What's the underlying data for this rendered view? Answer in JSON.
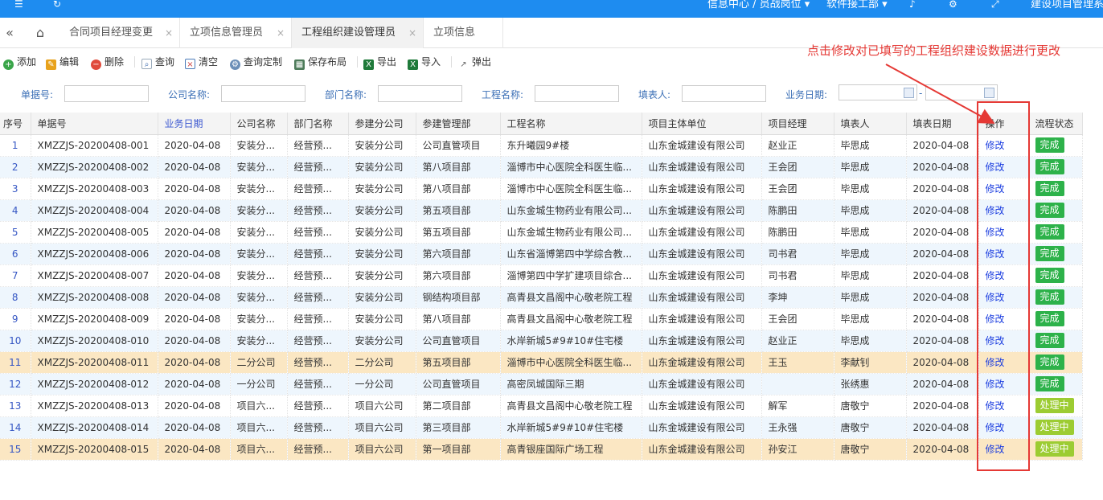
{
  "topbar": {
    "menu1": "信息中心 / 员战岗位 ▾",
    "menu2": "软件接工部 ▾",
    "menu3": "建设项目管理系"
  },
  "tabs": [
    {
      "label": "合同项目经理变更",
      "close": "×"
    },
    {
      "label": "立项信息管理员",
      "close": "×"
    },
    {
      "label": "工程组织建设管理员",
      "close": "×"
    },
    {
      "label": "立项信息",
      "close": ""
    }
  ],
  "toolbar": {
    "add": "添加",
    "edit": "编辑",
    "delete": "删除",
    "query": "查询",
    "clear": "清空",
    "custom_query": "查询定制",
    "save_layout": "保存布局",
    "export": "导出",
    "import": "导入",
    "popup": "弹出"
  },
  "search": {
    "doc_no": "单据号:",
    "company": "公司名称:",
    "dept": "部门名称:",
    "project": "工程名称:",
    "filler": "填表人:",
    "biz_date": "业务日期:",
    "date_sep": "-"
  },
  "columns": [
    "序号",
    "单据号",
    "业务日期",
    "公司名称",
    "部门名称",
    "参建分公司",
    "参建管理部",
    "工程名称",
    "项目主体单位",
    "项目经理",
    "填表人",
    "填表日期",
    "操作",
    "流程状态"
  ],
  "rows": [
    {
      "seq": "1",
      "no": "XMZZJS-20200408-001",
      "date": "2020-04-08",
      "company": "安装分...",
      "dept": "经营预...",
      "branch": "安装分公司",
      "mgr_dept": "公司直管项目",
      "project": "东升曦园9#楼",
      "owner": "山东金城建设有限公司",
      "pm": "赵业正",
      "filler": "毕思成",
      "fill_date": "2020-04-08",
      "op": "修改",
      "status": "完成",
      "style": ""
    },
    {
      "seq": "2",
      "no": "XMZZJS-20200408-002",
      "date": "2020-04-08",
      "company": "安装分...",
      "dept": "经营预...",
      "branch": "安装分公司",
      "mgr_dept": "第八项目部",
      "project": "淄博市中心医院全科医生临...",
      "owner": "山东金城建设有限公司",
      "pm": "王会团",
      "filler": "毕思成",
      "fill_date": "2020-04-08",
      "op": "修改",
      "status": "完成",
      "style": "alt"
    },
    {
      "seq": "3",
      "no": "XMZZJS-20200408-003",
      "date": "2020-04-08",
      "company": "安装分...",
      "dept": "经营预...",
      "branch": "安装分公司",
      "mgr_dept": "第八项目部",
      "project": "淄博市中心医院全科医生临...",
      "owner": "山东金城建设有限公司",
      "pm": "王会团",
      "filler": "毕思成",
      "fill_date": "2020-04-08",
      "op": "修改",
      "status": "完成",
      "style": ""
    },
    {
      "seq": "4",
      "no": "XMZZJS-20200408-004",
      "date": "2020-04-08",
      "company": "安装分...",
      "dept": "经营预...",
      "branch": "安装分公司",
      "mgr_dept": "第五项目部",
      "project": "山东金城生物药业有限公司...",
      "owner": "山东金城建设有限公司",
      "pm": "陈鹏田",
      "filler": "毕思成",
      "fill_date": "2020-04-08",
      "op": "修改",
      "status": "完成",
      "style": "alt"
    },
    {
      "seq": "5",
      "no": "XMZZJS-20200408-005",
      "date": "2020-04-08",
      "company": "安装分...",
      "dept": "经营预...",
      "branch": "安装分公司",
      "mgr_dept": "第五项目部",
      "project": "山东金城生物药业有限公司...",
      "owner": "山东金城建设有限公司",
      "pm": "陈鹏田",
      "filler": "毕思成",
      "fill_date": "2020-04-08",
      "op": "修改",
      "status": "完成",
      "style": ""
    },
    {
      "seq": "6",
      "no": "XMZZJS-20200408-006",
      "date": "2020-04-08",
      "company": "安装分...",
      "dept": "经营预...",
      "branch": "安装分公司",
      "mgr_dept": "第六项目部",
      "project": "山东省淄博第四中学综合教...",
      "owner": "山东金城建设有限公司",
      "pm": "司书君",
      "filler": "毕思成",
      "fill_date": "2020-04-08",
      "op": "修改",
      "status": "完成",
      "style": "alt"
    },
    {
      "seq": "7",
      "no": "XMZZJS-20200408-007",
      "date": "2020-04-08",
      "company": "安装分...",
      "dept": "经营预...",
      "branch": "安装分公司",
      "mgr_dept": "第六项目部",
      "project": "淄博第四中学扩建项目综合...",
      "owner": "山东金城建设有限公司",
      "pm": "司书君",
      "filler": "毕思成",
      "fill_date": "2020-04-08",
      "op": "修改",
      "status": "完成",
      "style": ""
    },
    {
      "seq": "8",
      "no": "XMZZJS-20200408-008",
      "date": "2020-04-08",
      "company": "安装分...",
      "dept": "经营预...",
      "branch": "安装分公司",
      "mgr_dept": "钢结构项目部",
      "project": "高青县文昌阁中心敬老院工程",
      "owner": "山东金城建设有限公司",
      "pm": "李坤",
      "filler": "毕思成",
      "fill_date": "2020-04-08",
      "op": "修改",
      "status": "完成",
      "style": "alt"
    },
    {
      "seq": "9",
      "no": "XMZZJS-20200408-009",
      "date": "2020-04-08",
      "company": "安装分...",
      "dept": "经营预...",
      "branch": "安装分公司",
      "mgr_dept": "第八项目部",
      "project": "高青县文昌阁中心敬老院工程",
      "owner": "山东金城建设有限公司",
      "pm": "王会团",
      "filler": "毕思成",
      "fill_date": "2020-04-08",
      "op": "修改",
      "status": "完成",
      "style": ""
    },
    {
      "seq": "10",
      "no": "XMZZJS-20200408-010",
      "date": "2020-04-08",
      "company": "安装分...",
      "dept": "经营预...",
      "branch": "安装分公司",
      "mgr_dept": "公司直管项目",
      "project": "水岸新城5#9#10#住宅楼",
      "owner": "山东金城建设有限公司",
      "pm": "赵业正",
      "filler": "毕思成",
      "fill_date": "2020-04-08",
      "op": "修改",
      "status": "完成",
      "style": "alt"
    },
    {
      "seq": "11",
      "no": "XMZZJS-20200408-011",
      "date": "2020-04-08",
      "company": "二分公司",
      "dept": "经营预...",
      "branch": "二分公司",
      "mgr_dept": "第五项目部",
      "project": "淄博市中心医院全科医生临...",
      "owner": "山东金城建设有限公司",
      "pm": "王玉",
      "filler": "李献钊",
      "fill_date": "2020-04-08",
      "op": "修改",
      "status": "完成",
      "style": "hl"
    },
    {
      "seq": "12",
      "no": "XMZZJS-20200408-012",
      "date": "2020-04-08",
      "company": "一分公司",
      "dept": "经营预...",
      "branch": "一分公司",
      "mgr_dept": "公司直管项目",
      "project": "高密凤城国际三期",
      "owner": "山东金城建设有限公司",
      "pm": "",
      "filler": "张绣惠",
      "fill_date": "2020-04-08",
      "op": "修改",
      "status": "完成",
      "style": "alt"
    },
    {
      "seq": "13",
      "no": "XMZZJS-20200408-013",
      "date": "2020-04-08",
      "company": "项目六...",
      "dept": "经营预...",
      "branch": "项目六公司",
      "mgr_dept": "第二项目部",
      "project": "高青县文昌阁中心敬老院工程",
      "owner": "山东金城建设有限公司",
      "pm": "解军",
      "filler": "唐敬宁",
      "fill_date": "2020-04-08",
      "op": "修改",
      "status": "处理中",
      "style": ""
    },
    {
      "seq": "14",
      "no": "XMZZJS-20200408-014",
      "date": "2020-04-08",
      "company": "项目六...",
      "dept": "经营预...",
      "branch": "项目六公司",
      "mgr_dept": "第三项目部",
      "project": "水岸新城5#9#10#住宅楼",
      "owner": "山东金城建设有限公司",
      "pm": "王永强",
      "filler": "唐敬宁",
      "fill_date": "2020-04-08",
      "op": "修改",
      "status": "处理中",
      "style": "alt"
    },
    {
      "seq": "15",
      "no": "XMZZJS-20200408-015",
      "date": "2020-04-08",
      "company": "项目六...",
      "dept": "经营预...",
      "branch": "项目六公司",
      "mgr_dept": "第一项目部",
      "project": "高青银座国际广场工程",
      "owner": "山东金城建设有限公司",
      "pm": "孙安江",
      "filler": "唐敬宁",
      "fill_date": "2020-04-08",
      "op": "修改",
      "status": "处理中",
      "style": "hl"
    }
  ],
  "annotation": "点击修改对已填写的工程组织建设数据进行更改",
  "colors": {
    "accent": "#1e8cf0",
    "annotation": "#e53935",
    "done": "#2db24a",
    "processing": "#9ccc32",
    "highlight_row": "#fbe7c3",
    "alt_row": "#eef6fd"
  }
}
